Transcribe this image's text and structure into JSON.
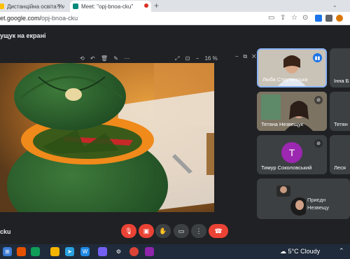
{
  "browser": {
    "tabs": [
      {
        "label": "Дистанційна освіта Уманський",
        "active": false
      },
      {
        "label": "Meet: \"opj-bnoa-cku\"",
        "active": true
      }
    ],
    "url_prefix": "et.google.com/",
    "url_path": "opj-bnoa-cku"
  },
  "meet": {
    "presenting_label": "ущук на екрані",
    "zoom": "16 %",
    "meeting_code": "cku",
    "participants": [
      {
        "name": "Люба Струтинська",
        "speaking": true
      },
      {
        "name": "Інна Б",
        "speaking": false
      },
      {
        "name": "Тетяна Незвещук",
        "speaking": false
      },
      {
        "name": "Тетян",
        "speaking": false
      },
      {
        "name": "Тимур Соколовський",
        "avatar_letter": "T",
        "muted": true
      },
      {
        "name": "Леся",
        "speaking": false
      },
      {
        "name": "Приєдн",
        "subtitle": "Незвещу"
      }
    ]
  },
  "taskbar": {
    "weather": "5°C  Cloudy"
  },
  "colors": {
    "meet_bg": "#202124",
    "tile_bg": "#3c4043",
    "active_border": "#8ab4f8",
    "end_call": "#ea4335",
    "avatar": "#9c27b0"
  }
}
